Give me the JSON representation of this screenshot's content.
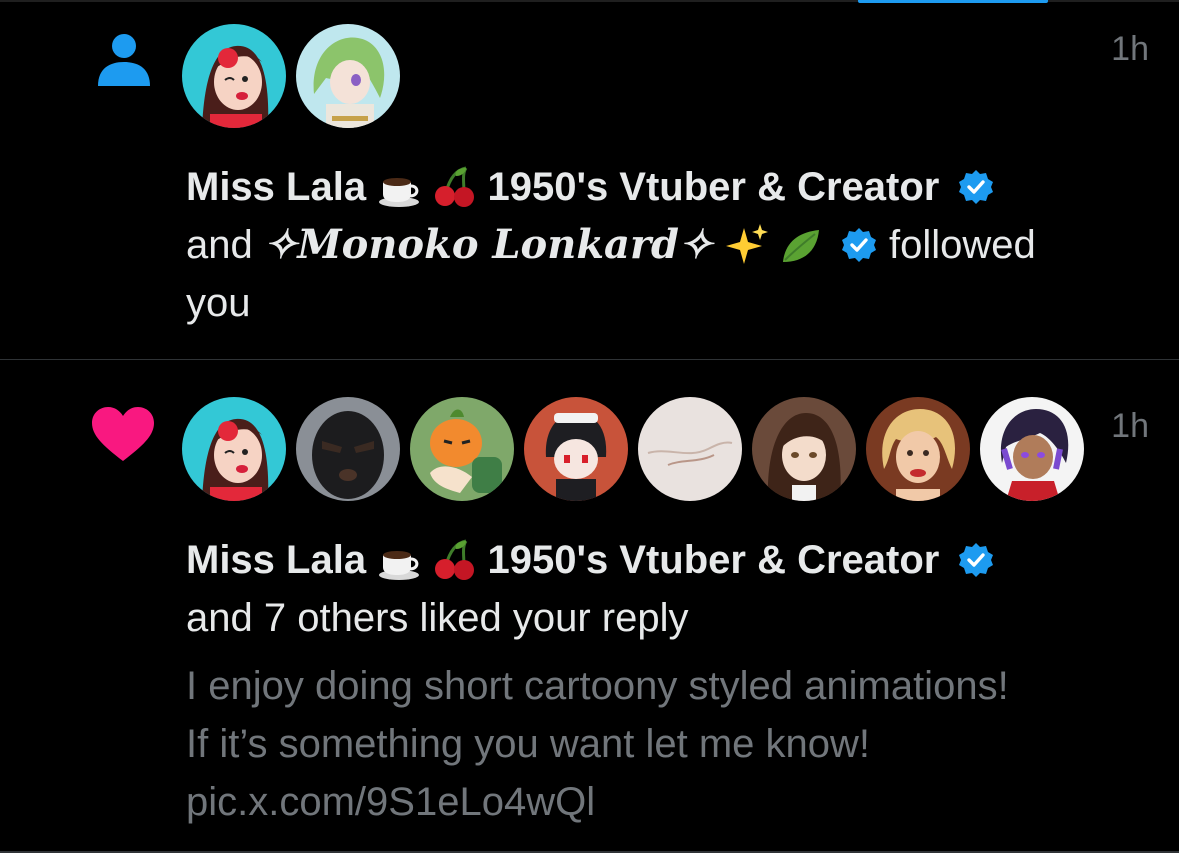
{
  "colors": {
    "background": "#000000",
    "text_primary": "#e7e9ea",
    "text_secondary": "#71767b",
    "follow_icon": "#1d9bf0",
    "like_icon": "#f91880",
    "verified": "#1d9bf0",
    "divider": "#2f3336"
  },
  "notifications": [
    {
      "type": "follow",
      "icon": "person-icon",
      "time": "1h",
      "avatars": [
        "miss-lala-avatar",
        "monoko-lonkard-avatar"
      ],
      "actor_1": "Miss Lala",
      "actor_1_suffix": "1950's Vtuber & Creator",
      "joiner": "and",
      "actor_2_prefix": "✧",
      "actor_2": "Monoko Lonkard",
      "actor_2_suffix": "✧",
      "action": "followed",
      "action_2": "you"
    },
    {
      "type": "like",
      "icon": "heart-icon",
      "time": "1h",
      "avatars": [
        "miss-lala-avatar",
        "masked-avatar",
        "orange-character-avatar",
        "maid-character-avatar",
        "blank-avatar",
        "brown-hair-avatar",
        "blonde-woman-avatar",
        "purple-hair-avatar"
      ],
      "actor_1": "Miss Lala",
      "actor_1_suffix": "1950's Vtuber & Creator",
      "summary": "and 7 others liked your reply",
      "reply_line_1": "I enjoy doing short cartoony styled animations!",
      "reply_line_2": "If it’s something you want let me know!",
      "reply_link": "pic.x.com/9S1eLo4wQl"
    }
  ]
}
